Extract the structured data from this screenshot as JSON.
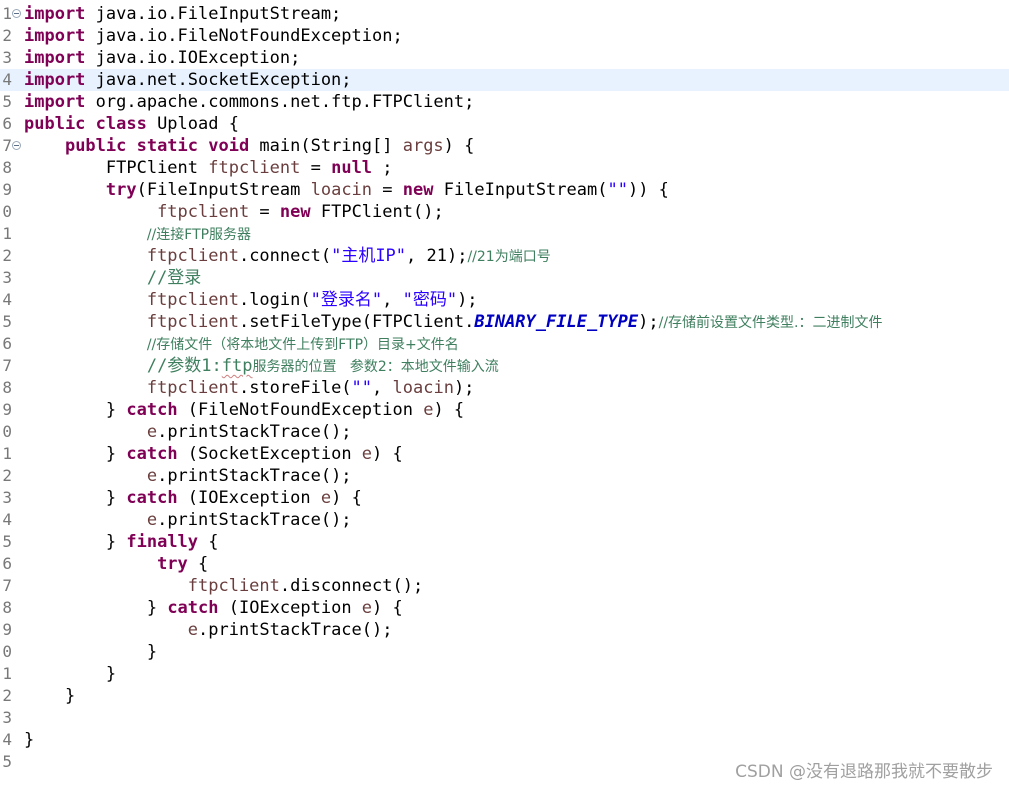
{
  "editor": {
    "line_numbers": [
      "1",
      "2",
      "3",
      "4",
      "5",
      "6",
      "7",
      "8",
      "9",
      "0",
      "1",
      "2",
      "3",
      "4",
      "5",
      "6",
      "7",
      "8",
      "9",
      "0",
      "1",
      "2",
      "3",
      "4",
      "5",
      "6",
      "7",
      "8",
      "9",
      "0",
      "1",
      "2",
      "3",
      "4",
      "5"
    ],
    "folds": {
      "line1": "collapse",
      "line7": "collapse"
    },
    "current_line": 4,
    "lines": {
      "l1": {
        "kw": "import",
        "rest": " java.io.FileInputStream;"
      },
      "l2": {
        "kw": "import",
        "rest": " java.io.FileNotFoundException;"
      },
      "l3": {
        "kw": "import",
        "rest": " java.io.IOException;"
      },
      "l4": {
        "kw": "import",
        "rest": " java.net.SocketException;"
      },
      "l5": {
        "kw": "import",
        "rest": " org.apache.commons.net.ftp.FTPClient;"
      },
      "l6": {
        "kw": "public class",
        "rest": " Upload {"
      },
      "l7": {
        "indent": "    ",
        "kw": "public static void",
        "rest_a": " main(String[] ",
        "var": "args",
        "rest_b": ") {"
      },
      "l8": {
        "indent": "        ",
        "t1": "FTPClient ",
        "var": "ftpclient",
        "t2": " = ",
        "kw": "null",
        "t3": " ;"
      },
      "l9": {
        "indent": "        ",
        "kw1": "try",
        "t1": "(FileInputStream ",
        "var": "loacin",
        "t2": " = ",
        "kw2": "new",
        "t3": " FileInputStream(",
        "str": "\"\"",
        "t4": ")) {"
      },
      "l10": {
        "indent": "             ",
        "var": "ftpclient",
        "t1": " = ",
        "kw": "new",
        "t2": " FTPClient();"
      },
      "l11": {
        "indent": "            ",
        "cm": "//连接FTP服务器"
      },
      "l12": {
        "indent": "            ",
        "var": "ftpclient",
        "t1": ".connect(",
        "str": "\"主机IP\"",
        "t2": ", 21);",
        "cm": "//21为端口号"
      },
      "l13": {
        "indent": "            ",
        "cm": "//登录"
      },
      "l14": {
        "indent": "            ",
        "var": "ftpclient",
        "t1": ".login(",
        "str1": "\"登录名\"",
        "t2": ", ",
        "str2": "\"密码\"",
        "t3": ");"
      },
      "l15": {
        "indent": "            ",
        "var": "ftpclient",
        "t1": ".setFileType(FTPClient.",
        "cst": "BINARY_FILE_TYPE",
        "t2": ");",
        "cm": "//存储前设置文件类型.：二进制文件"
      },
      "l16": {
        "indent": "            ",
        "cm": "//存储文件（将本地文件上传到FTP）目录+文件名"
      },
      "l17": {
        "indent": "            ",
        "cm_a": "//参数1:",
        "cm_squig": "ftp",
        "cm_b": "服务器的位置   参数2：本地文件输入流"
      },
      "l18": {
        "indent": "            ",
        "var1": "ftpclient",
        "t1": ".storeFile(",
        "str": "\"\"",
        "t2": ", ",
        "var2": "loacin",
        "t3": ");"
      },
      "l19": {
        "indent": "        ",
        "t1": "} ",
        "kw": "catch",
        "t2": " (FileNotFoundException ",
        "var": "e",
        "t3": ") {"
      },
      "l20": {
        "indent": "            ",
        "var": "e",
        "t1": ".printStackTrace();"
      },
      "l21": {
        "indent": "        ",
        "t1": "} ",
        "kw": "catch",
        "t2": " (SocketException ",
        "var": "e",
        "t3": ") {"
      },
      "l22": {
        "indent": "            ",
        "var": "e",
        "t1": ".printStackTrace();"
      },
      "l23": {
        "indent": "        ",
        "t1": "} ",
        "kw": "catch",
        "t2": " (IOException ",
        "var": "e",
        "t3": ") {"
      },
      "l24": {
        "indent": "            ",
        "var": "e",
        "t1": ".printStackTrace();"
      },
      "l25": {
        "indent": "        ",
        "t1": "} ",
        "kw": "finally",
        "t2": " {"
      },
      "l26": {
        "indent": "             ",
        "kw": "try",
        "t1": " {"
      },
      "l27": {
        "indent": "                ",
        "var": "ftpclient",
        "t1": ".disconnect();"
      },
      "l28": {
        "indent": "            ",
        "t1": "} ",
        "kw": "catch",
        "t2": " (IOException ",
        "var": "e",
        "t3": ") {"
      },
      "l29": {
        "indent": "                ",
        "var": "e",
        "t1": ".printStackTrace();"
      },
      "l30": {
        "indent": "            ",
        "t1": "}"
      },
      "l31": {
        "indent": "        ",
        "t1": "}"
      },
      "l32": {
        "indent": "    ",
        "t1": "}"
      },
      "l33": {},
      "l34": {
        "t1": "}"
      },
      "l35": {}
    }
  },
  "watermark": {
    "text": "CSDN @没有退路那我就不要散步"
  },
  "colors": {
    "keyword": "#7f0055",
    "string": "#2a00ff",
    "comment": "#3f7f5f",
    "variable": "#6a3e3e",
    "constant": "#0000c0",
    "current_line": "#e8f2fe"
  }
}
